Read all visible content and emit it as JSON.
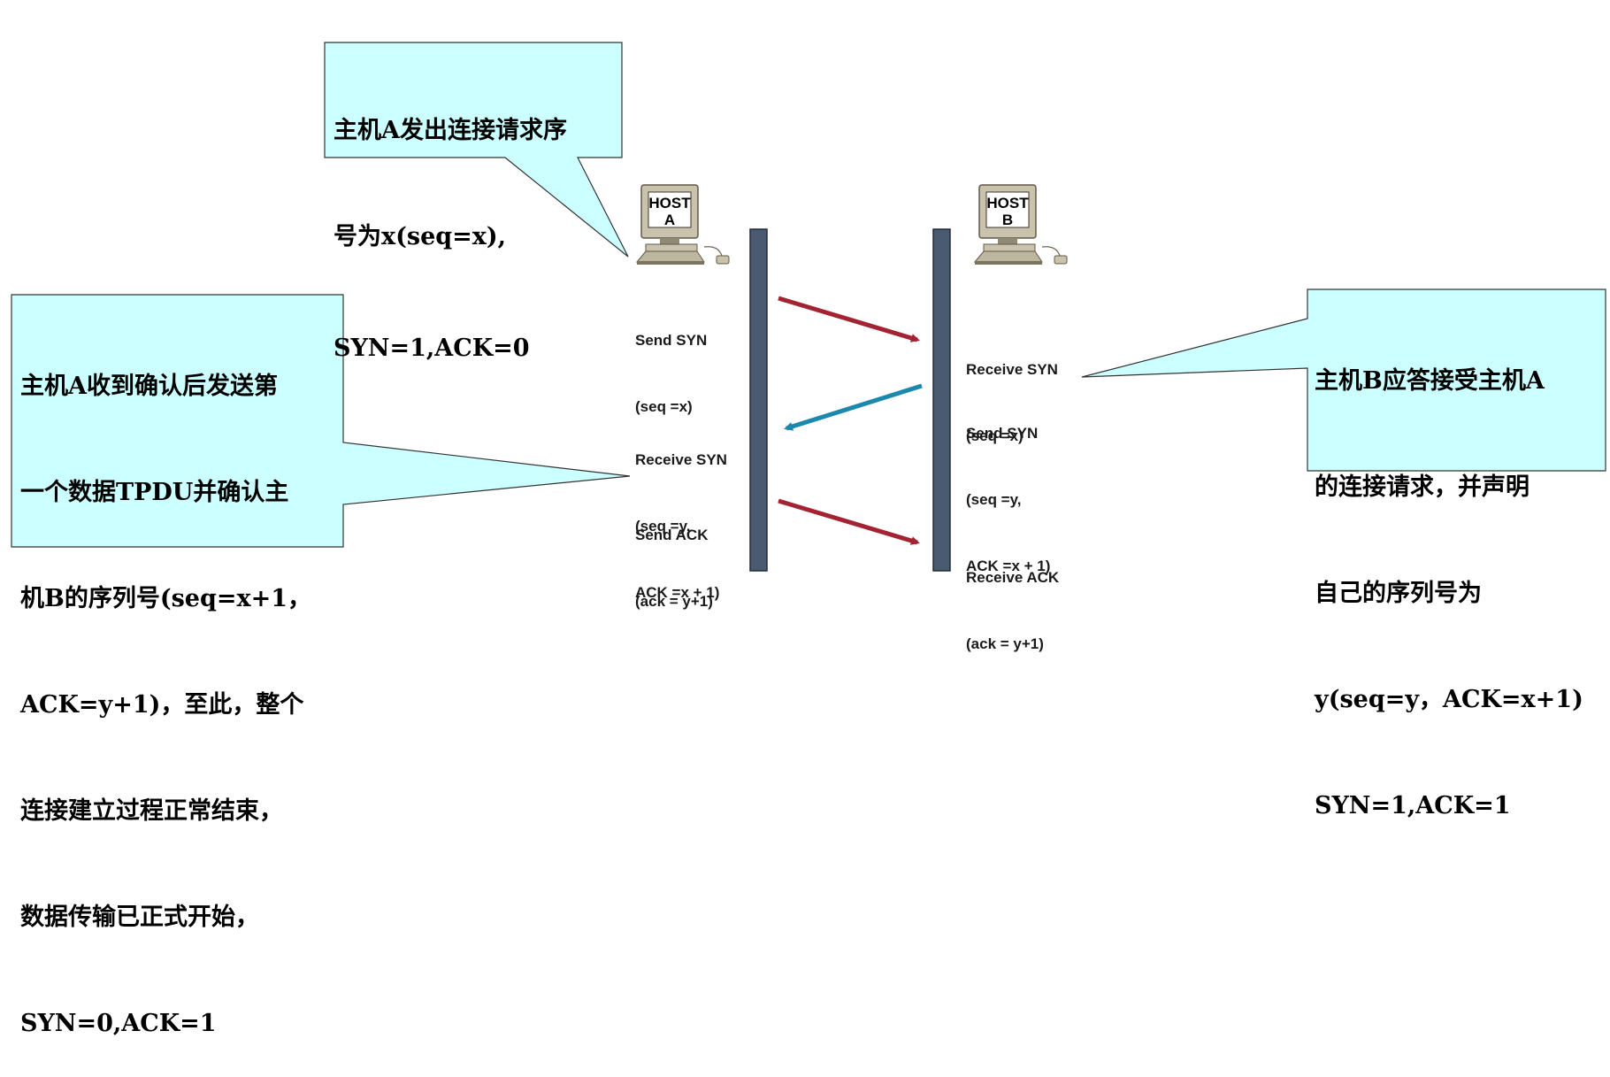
{
  "colors": {
    "callout_fill": "#ccffff",
    "callout_border": "#333333",
    "timeline_fill": "#4a5a70",
    "arrow_red": "#a32332",
    "arrow_blue": "#1b88ad"
  },
  "icons": [
    "computer-icon",
    "computer-icon"
  ],
  "host_a": {
    "line1": "HOST",
    "line2": "A"
  },
  "host_b": {
    "line1": "HOST",
    "line2": "B"
  },
  "callouts": {
    "top": {
      "lines": [
        "主机A发出连接请求序",
        "号为x(seq=x),",
        "SYN=1,ACK=0"
      ]
    },
    "left": {
      "lines": [
        "主机A收到确认后发送第",
        "一个数据TPDU并确认主",
        "机B的序列号(seq=x+1，",
        "ACK=y+1)，至此，整个",
        "连接建立过程正常结束，",
        "数据传输已正式开始，",
        "SYN=0,ACK=1"
      ]
    },
    "right": {
      "lines": [
        "主机B应答接受主机A",
        "的连接请求，并声明",
        "自己的序列号为",
        "y(seq=y，ACK=x+1)",
        "SYN=1,ACK=1"
      ]
    }
  },
  "host_a_labels": {
    "send_syn": {
      "line1": "Send SYN",
      "line2": "(seq =x)"
    },
    "receive_syn": {
      "line1": "Receive SYN",
      "line2": "(seq =y,",
      "line3": "ACK =x + 1)"
    },
    "send_ack": {
      "line1": "Send ACK",
      "line2": "(ack = y+1)"
    }
  },
  "host_b_labels": {
    "receive_syn": {
      "line1": "Receive SYN",
      "line2": "(seq =x)"
    },
    "send_syn": {
      "line1": "Send SYN",
      "line2": "(seq =y,",
      "line3": "ACK =x + 1)"
    },
    "receive_ack": {
      "line1": "Receive ACK",
      "line2": "(ack = y+1)"
    }
  }
}
